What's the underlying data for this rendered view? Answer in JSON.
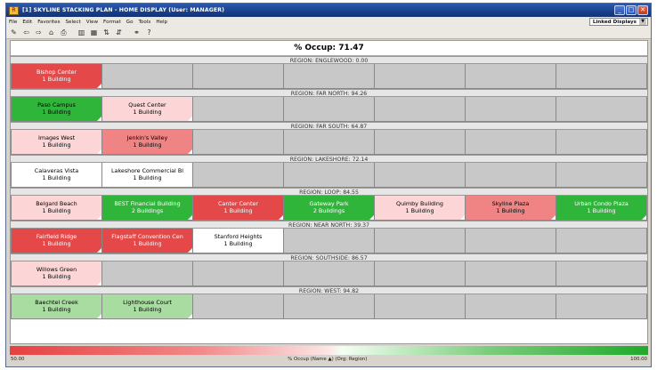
{
  "window": {
    "app_icon": "R",
    "title": "[1] SKYLINE STACKING PLAN - HOME DISPLAY  (User: MANAGER)",
    "controls": {
      "minimize": "_",
      "maximize": "□",
      "close": "✕"
    }
  },
  "menu": [
    "File",
    "Edit",
    "Favorites",
    "Select",
    "View",
    "Format",
    "Go",
    "Tools",
    "Help"
  ],
  "linked_displays": {
    "label": "Linked Displays",
    "arrow": "▼"
  },
  "toolbar_icons": [
    {
      "name": "pencil-icon",
      "glyph": "✎"
    },
    {
      "name": "back-arrow-icon",
      "glyph": "⇦"
    },
    {
      "name": "forward-arrow-icon",
      "glyph": "⇨"
    },
    {
      "name": "home-icon",
      "glyph": "⌂"
    },
    {
      "name": "print-icon",
      "glyph": "⎙"
    },
    {
      "name": "bar-chart-icon",
      "glyph": "▥"
    },
    {
      "name": "grid-icon",
      "glyph": "▦"
    },
    {
      "name": "sort-icon",
      "glyph": "⇅"
    },
    {
      "name": "sort-desc-icon",
      "glyph": "⇵"
    },
    {
      "name": "binoculars-icon",
      "glyph": "⚭"
    },
    {
      "name": "help-icon",
      "glyph": "?"
    }
  ],
  "header": {
    "title": "% Occup: 71.47"
  },
  "colors": {
    "strong_red": "#e44848",
    "light_red": "#f08484",
    "pale_red": "#fcd6d6",
    "white": "#ffffff",
    "pale_green": "#a8dca0",
    "strong_green": "#2fb63a",
    "empty": "#c8c8c8"
  },
  "regions": [
    {
      "label": "REGION: ENGLEWOOD: 0.00",
      "cells": [
        {
          "name": "Bishop Center",
          "count": "1 Building",
          "color": "strong_red",
          "text": "#ffffff"
        }
      ]
    },
    {
      "label": "REGION: FAR NORTH: 94.26",
      "cells": [
        {
          "name": "Paso Campus",
          "count": "1 Building",
          "color": "strong_green",
          "text": "#000000"
        },
        {
          "name": "Quest Center",
          "count": "1 Building",
          "color": "pale_red",
          "text": "#000000"
        }
      ]
    },
    {
      "label": "REGION: FAR SOUTH: 64.87",
      "cells": [
        {
          "name": "Images West",
          "count": "1 Building",
          "color": "pale_red",
          "text": "#000000"
        },
        {
          "name": "Jenkin's Valley",
          "count": "1 Building",
          "color": "light_red",
          "text": "#000000"
        }
      ]
    },
    {
      "label": "REGION: LAKESHORE: 72.14",
      "cells": [
        {
          "name": "Calaveras Vista",
          "count": "1 Building",
          "color": "white",
          "text": "#000000"
        },
        {
          "name": "Lakeshore Commercial Bl",
          "count": "1 Building",
          "color": "white",
          "text": "#000000"
        }
      ]
    },
    {
      "label": "REGION: LOOP: 84.55",
      "cells": [
        {
          "name": "Belgard Beach",
          "count": "1 Building",
          "color": "pale_red",
          "text": "#000000"
        },
        {
          "name": "BEST Financial Building",
          "count": "2 Buildings",
          "color": "strong_green",
          "text": "#ffffff"
        },
        {
          "name": "Canter Center",
          "count": "1 Building",
          "color": "strong_red",
          "text": "#ffffff"
        },
        {
          "name": "Gateway Park",
          "count": "2 Buildings",
          "color": "strong_green",
          "text": "#ffffff"
        },
        {
          "name": "Quimby Building",
          "count": "1 Building",
          "color": "pale_red",
          "text": "#000000"
        },
        {
          "name": "Skyline Plaza",
          "count": "1 Building",
          "color": "light_red",
          "text": "#000000"
        },
        {
          "name": "Urban Condo Plaza",
          "count": "1 Building",
          "color": "strong_green",
          "text": "#ffffff"
        }
      ]
    },
    {
      "label": "REGION: NEAR NORTH: 39.37",
      "cells": [
        {
          "name": "Fairfield Ridge",
          "count": "1 Building",
          "color": "strong_red",
          "text": "#ffffff"
        },
        {
          "name": "Flagstaff Convention Cen",
          "count": "1 Building",
          "color": "strong_red",
          "text": "#ffffff"
        },
        {
          "name": "Stanford Heights",
          "count": "1 Building",
          "color": "white",
          "text": "#000000"
        }
      ]
    },
    {
      "label": "REGION: SOUTHSIDE: 86.57",
      "cells": [
        {
          "name": "Willows Green",
          "count": "1 Building",
          "color": "pale_red",
          "text": "#000000"
        }
      ]
    },
    {
      "label": "REGION: WEST: 94.82",
      "cells": [
        {
          "name": "Baechtel Creek",
          "count": "1 Building",
          "color": "pale_green",
          "text": "#000000"
        },
        {
          "name": "Lighthouse Court",
          "count": "1 Building",
          "color": "pale_green",
          "text": "#000000"
        }
      ]
    }
  ],
  "legend": {
    "min": "50.00",
    "max": "100.00",
    "caption": "% Occup  (Name ▲)  (Org: Region)"
  }
}
